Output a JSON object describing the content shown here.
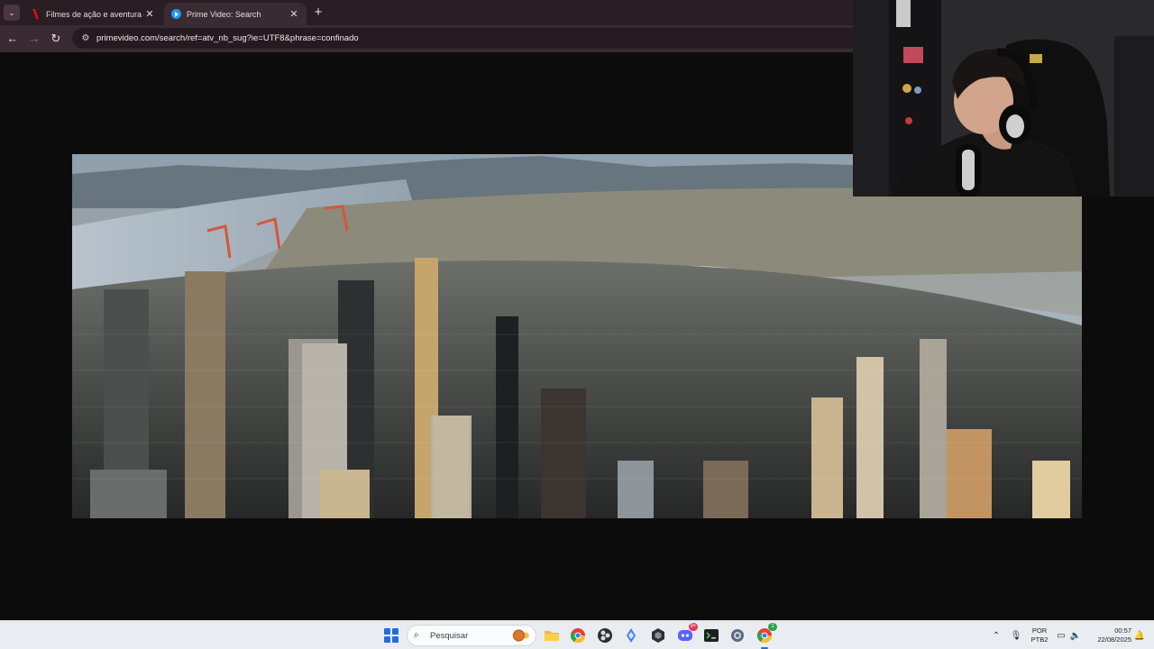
{
  "browser": {
    "tabs": [
      {
        "title": "Filmes de ação e aventura – Ne",
        "favicon": "netflix-icon",
        "active": false
      },
      {
        "title": "Prime Video: Search",
        "favicon": "prime-video-icon",
        "active": true
      }
    ],
    "close_glyph": "✕",
    "new_tab_glyph": "+",
    "url": "primevideo.com/search/ref=atv_nb_sug?ie=UTF8&phrase=confinado",
    "colors": {
      "frame": "#2a1d23",
      "toolbar": "#3a2a31",
      "omnibox": "#261a20"
    }
  },
  "taskbar": {
    "search_placeholder": "Pesquisar",
    "pinned_apps": [
      {
        "name": "file-explorer-icon"
      },
      {
        "name": "chrome-icon"
      },
      {
        "name": "obs-icon"
      },
      {
        "name": "streamlabs-icon"
      },
      {
        "name": "app-hexagon-icon"
      },
      {
        "name": "discord-icon",
        "badge": "9+"
      },
      {
        "name": "terminal-icon"
      },
      {
        "name": "settings-icon"
      },
      {
        "name": "chrome-profile-icon",
        "badge": "1"
      }
    ],
    "language_line1": "POR",
    "language_line2": "PTB2",
    "time": "00:57",
    "date": "22/08/2025"
  }
}
